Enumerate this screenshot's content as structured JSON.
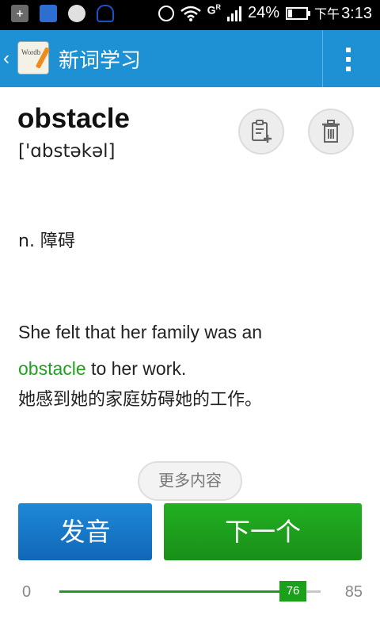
{
  "status_bar": {
    "network": "G",
    "network_sup": "R",
    "battery": "24%",
    "ampm": "下午",
    "time": "3:13"
  },
  "app_bar": {
    "title": "新词学习",
    "logo_text": "Wordb"
  },
  "word": {
    "term": "obstacle",
    "phonetic": "['ɑbstəkəl]",
    "definition": "n. 障碍",
    "example_before": "She felt that her family was an",
    "example_highlight": "obstacle",
    "example_after": " to her work.",
    "translation": "她感到她的家庭妨碍她的工作。"
  },
  "more_label": "更多内容",
  "actions": {
    "pronounce": "发音",
    "next": "下一个"
  },
  "progress": {
    "min": "0",
    "max": "85",
    "current": "76",
    "value": 76,
    "total": 85
  },
  "colors": {
    "app_bar": "#1e90d4",
    "highlight": "#1fa31f",
    "pronounce_button": "#1474c4",
    "next_button": "#1e9e1e"
  },
  "icons": {
    "add_note": "note-add-icon",
    "delete": "trash-icon"
  }
}
